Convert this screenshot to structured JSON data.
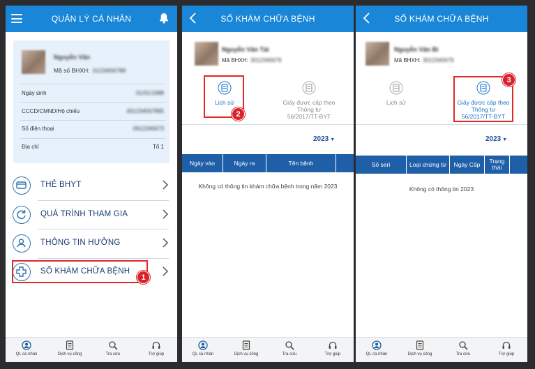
{
  "screen1": {
    "header_title": "QUẢN LÝ CÁ NHÂN",
    "user": {
      "name": "Nguyễn Văn",
      "bhxh_label": "Mã số BHXH:",
      "bhxh_value": "0123456789"
    },
    "info_rows": [
      {
        "label": "Ngày sinh",
        "value": "01/01/1988"
      },
      {
        "label": "CCCD/CMND/Hộ chiếu",
        "value": "001234567895"
      },
      {
        "label": "Số điện thoại",
        "value": "0912345673"
      },
      {
        "label": "Địa chỉ",
        "value": "Tổ 1"
      }
    ],
    "menu": [
      {
        "label": "THẺ BHYT",
        "icon": "card-icon"
      },
      {
        "label": "QUÁ TRÌNH THAM GIA",
        "icon": "refresh-icon"
      },
      {
        "label": "THÔNG TIN HƯỞNG",
        "icon": "user-icon"
      },
      {
        "label": "SỔ KHÁM CHỮA BỆNH",
        "icon": "plus-icon"
      }
    ],
    "step_badge": "1"
  },
  "screen2": {
    "header_title": "SỔ KHÁM CHỮA BỆNH",
    "user": {
      "name": "Nguyễn Văn Tài",
      "bhxh_label": "Mã BHXH:",
      "bhxh_value": "3012345679"
    },
    "options": [
      {
        "label": "Lịch sử",
        "active": true
      },
      {
        "label": "Giấy được cấp theo Thông tư 56/2017/TT-BYT",
        "active": false
      }
    ],
    "year": "2023",
    "columns": [
      "Ngày vào",
      "Ngày ra",
      "Tên bệnh"
    ],
    "empty_message": "Không có thông tin khám chữa bệnh trong năm 2023",
    "step_badge": "2"
  },
  "screen3": {
    "header_title": "SỔ KHÁM CHỮA BỆNH",
    "user": {
      "name": "Nguyễn Văn Bi",
      "bhxh_label": "Mã BHXH:",
      "bhxh_value": "3012345679"
    },
    "options": [
      {
        "label": "Lịch sử",
        "active": false
      },
      {
        "label": "Giấy được cấp theo Thông tư 56/2017/TT-BYT",
        "active": true
      }
    ],
    "year": "2023",
    "columns": [
      "Số seri",
      "Loại chứng từ",
      "Ngày Cấp",
      "Trạng thái"
    ],
    "empty_message": "Không có thông tin 2023",
    "step_badge": "3"
  },
  "tabbar": [
    {
      "label": "QL cá nhân",
      "icon": "person-circle-icon"
    },
    {
      "label": "Dịch vụ công",
      "icon": "document-icon"
    },
    {
      "label": "Tra cứu",
      "icon": "search-icon"
    },
    {
      "label": "Trợ giúp",
      "icon": "headset-icon"
    }
  ],
  "colors": {
    "header_blue": "#1a86d8",
    "table_header_blue": "#1f5fa8",
    "highlight_red": "#e02828",
    "card_bg": "#e7f1fb"
  }
}
